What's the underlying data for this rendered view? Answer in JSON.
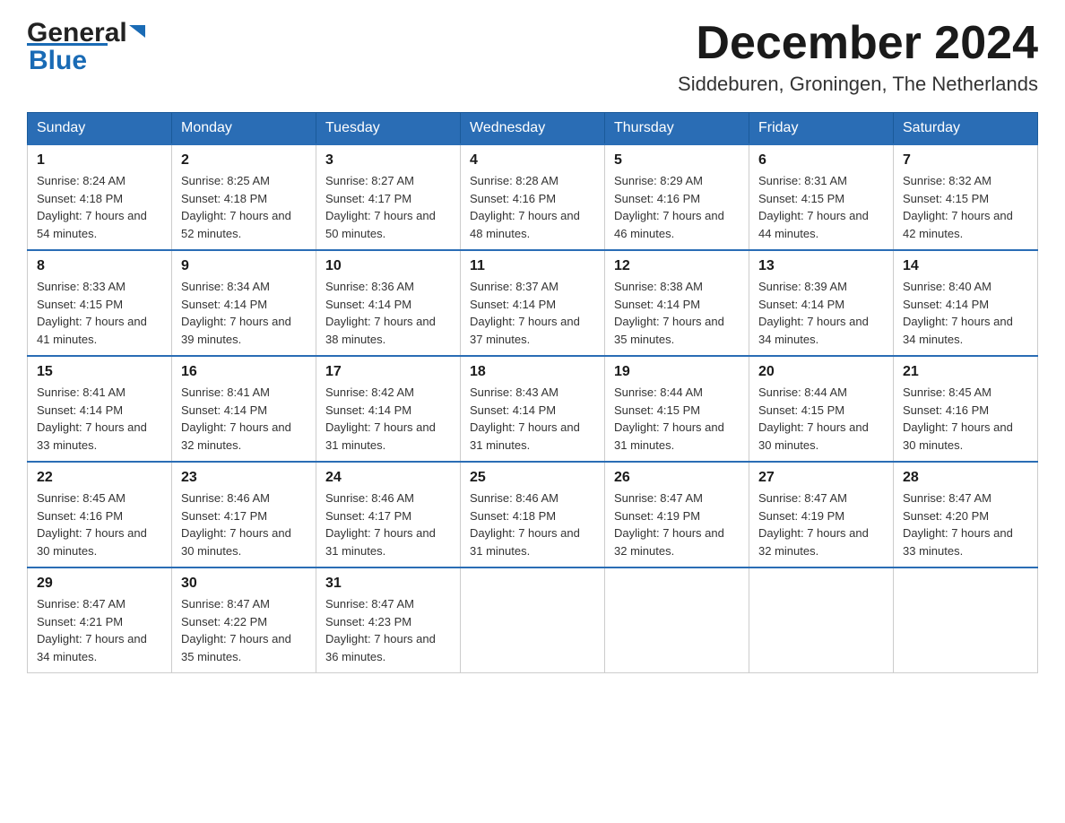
{
  "header": {
    "logo_general": "General",
    "logo_blue": "Blue",
    "month_title": "December 2024",
    "subtitle": "Siddeburen, Groningen, The Netherlands"
  },
  "weekdays": [
    "Sunday",
    "Monday",
    "Tuesday",
    "Wednesday",
    "Thursday",
    "Friday",
    "Saturday"
  ],
  "weeks": [
    [
      {
        "day": "1",
        "sunrise": "8:24 AM",
        "sunset": "4:18 PM",
        "daylight": "7 hours and 54 minutes."
      },
      {
        "day": "2",
        "sunrise": "8:25 AM",
        "sunset": "4:18 PM",
        "daylight": "7 hours and 52 minutes."
      },
      {
        "day": "3",
        "sunrise": "8:27 AM",
        "sunset": "4:17 PM",
        "daylight": "7 hours and 50 minutes."
      },
      {
        "day": "4",
        "sunrise": "8:28 AM",
        "sunset": "4:16 PM",
        "daylight": "7 hours and 48 minutes."
      },
      {
        "day": "5",
        "sunrise": "8:29 AM",
        "sunset": "4:16 PM",
        "daylight": "7 hours and 46 minutes."
      },
      {
        "day": "6",
        "sunrise": "8:31 AM",
        "sunset": "4:15 PM",
        "daylight": "7 hours and 44 minutes."
      },
      {
        "day": "7",
        "sunrise": "8:32 AM",
        "sunset": "4:15 PM",
        "daylight": "7 hours and 42 minutes."
      }
    ],
    [
      {
        "day": "8",
        "sunrise": "8:33 AM",
        "sunset": "4:15 PM",
        "daylight": "7 hours and 41 minutes."
      },
      {
        "day": "9",
        "sunrise": "8:34 AM",
        "sunset": "4:14 PM",
        "daylight": "7 hours and 39 minutes."
      },
      {
        "day": "10",
        "sunrise": "8:36 AM",
        "sunset": "4:14 PM",
        "daylight": "7 hours and 38 minutes."
      },
      {
        "day": "11",
        "sunrise": "8:37 AM",
        "sunset": "4:14 PM",
        "daylight": "7 hours and 37 minutes."
      },
      {
        "day": "12",
        "sunrise": "8:38 AM",
        "sunset": "4:14 PM",
        "daylight": "7 hours and 35 minutes."
      },
      {
        "day": "13",
        "sunrise": "8:39 AM",
        "sunset": "4:14 PM",
        "daylight": "7 hours and 34 minutes."
      },
      {
        "day": "14",
        "sunrise": "8:40 AM",
        "sunset": "4:14 PM",
        "daylight": "7 hours and 34 minutes."
      }
    ],
    [
      {
        "day": "15",
        "sunrise": "8:41 AM",
        "sunset": "4:14 PM",
        "daylight": "7 hours and 33 minutes."
      },
      {
        "day": "16",
        "sunrise": "8:41 AM",
        "sunset": "4:14 PM",
        "daylight": "7 hours and 32 minutes."
      },
      {
        "day": "17",
        "sunrise": "8:42 AM",
        "sunset": "4:14 PM",
        "daylight": "7 hours and 31 minutes."
      },
      {
        "day": "18",
        "sunrise": "8:43 AM",
        "sunset": "4:14 PM",
        "daylight": "7 hours and 31 minutes."
      },
      {
        "day": "19",
        "sunrise": "8:44 AM",
        "sunset": "4:15 PM",
        "daylight": "7 hours and 31 minutes."
      },
      {
        "day": "20",
        "sunrise": "8:44 AM",
        "sunset": "4:15 PM",
        "daylight": "7 hours and 30 minutes."
      },
      {
        "day": "21",
        "sunrise": "8:45 AM",
        "sunset": "4:16 PM",
        "daylight": "7 hours and 30 minutes."
      }
    ],
    [
      {
        "day": "22",
        "sunrise": "8:45 AM",
        "sunset": "4:16 PM",
        "daylight": "7 hours and 30 minutes."
      },
      {
        "day": "23",
        "sunrise": "8:46 AM",
        "sunset": "4:17 PM",
        "daylight": "7 hours and 30 minutes."
      },
      {
        "day": "24",
        "sunrise": "8:46 AM",
        "sunset": "4:17 PM",
        "daylight": "7 hours and 31 minutes."
      },
      {
        "day": "25",
        "sunrise": "8:46 AM",
        "sunset": "4:18 PM",
        "daylight": "7 hours and 31 minutes."
      },
      {
        "day": "26",
        "sunrise": "8:47 AM",
        "sunset": "4:19 PM",
        "daylight": "7 hours and 32 minutes."
      },
      {
        "day": "27",
        "sunrise": "8:47 AM",
        "sunset": "4:19 PM",
        "daylight": "7 hours and 32 minutes."
      },
      {
        "day": "28",
        "sunrise": "8:47 AM",
        "sunset": "4:20 PM",
        "daylight": "7 hours and 33 minutes."
      }
    ],
    [
      {
        "day": "29",
        "sunrise": "8:47 AM",
        "sunset": "4:21 PM",
        "daylight": "7 hours and 34 minutes."
      },
      {
        "day": "30",
        "sunrise": "8:47 AM",
        "sunset": "4:22 PM",
        "daylight": "7 hours and 35 minutes."
      },
      {
        "day": "31",
        "sunrise": "8:47 AM",
        "sunset": "4:23 PM",
        "daylight": "7 hours and 36 minutes."
      },
      null,
      null,
      null,
      null
    ]
  ]
}
